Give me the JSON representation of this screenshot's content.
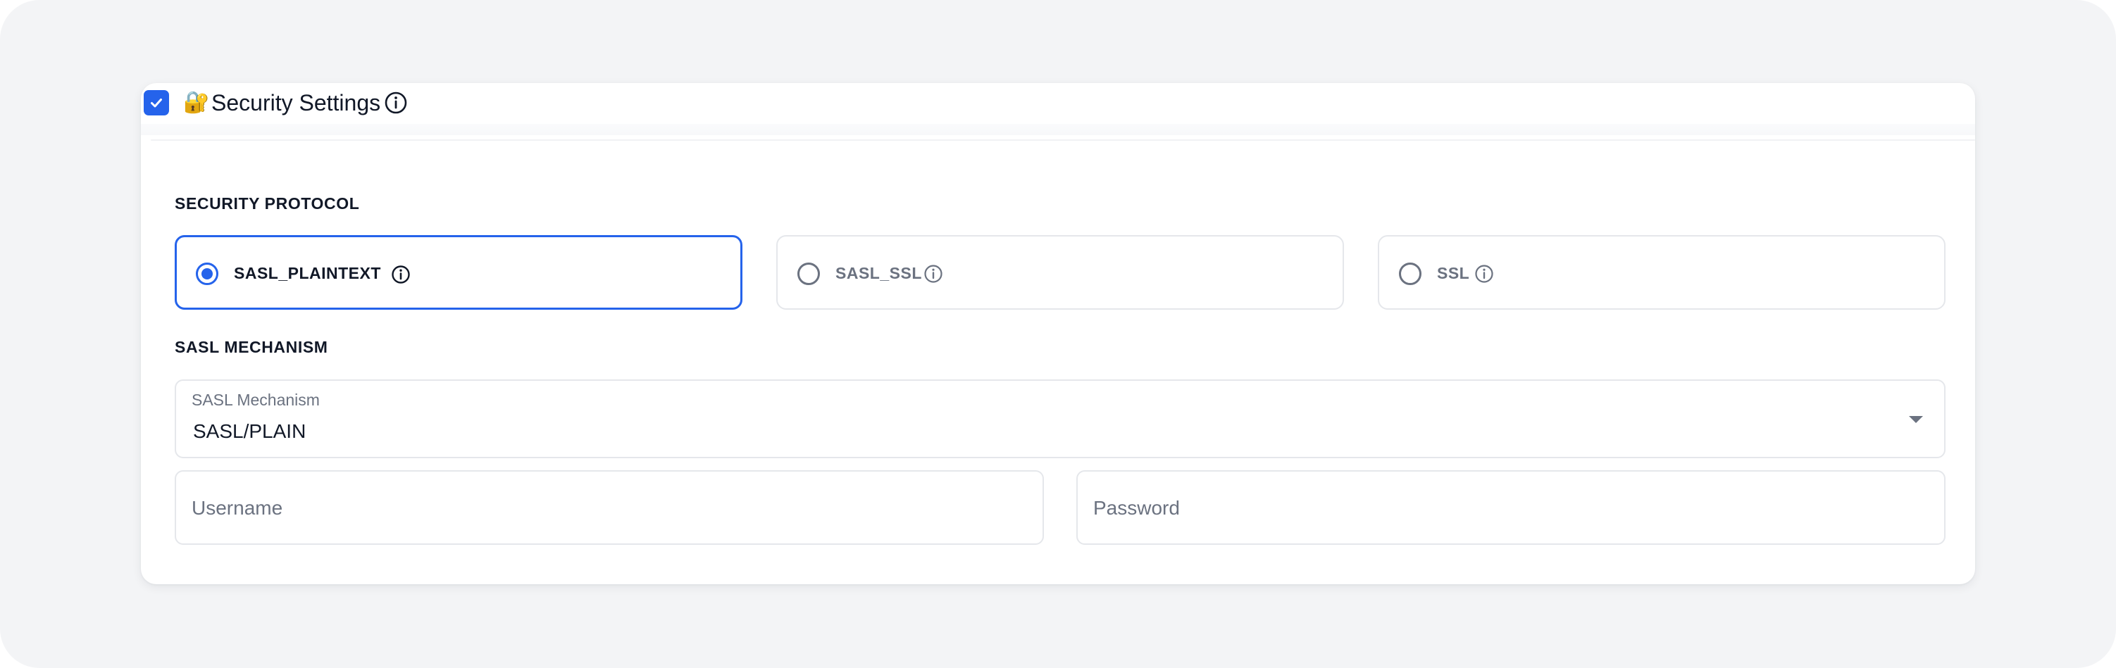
{
  "header": {
    "title": "Security Settings",
    "lock_glyph": "🔐",
    "enabled": true
  },
  "security_protocol": {
    "label": "SECURITY PROTOCOL",
    "options": [
      {
        "label": "SASL_PLAINTEXT",
        "selected": true
      },
      {
        "label": "SASL_SSL",
        "selected": false
      },
      {
        "label": "SSL",
        "selected": false
      }
    ]
  },
  "sasl_mechanism": {
    "section_label": "SASL MECHANISM",
    "field_label": "SASL Mechanism",
    "value": "SASL/PLAIN"
  },
  "credentials": {
    "username_placeholder": "Username",
    "password_placeholder": "Password"
  },
  "icons": {
    "checkbox": "check-icon",
    "info": "info-icon",
    "caret": "caret-down-icon"
  },
  "colors": {
    "accent": "#2563eb",
    "text": "#111827",
    "muted": "#6b7280",
    "border": "#e5e7eb",
    "background": "#f3f4f6"
  }
}
